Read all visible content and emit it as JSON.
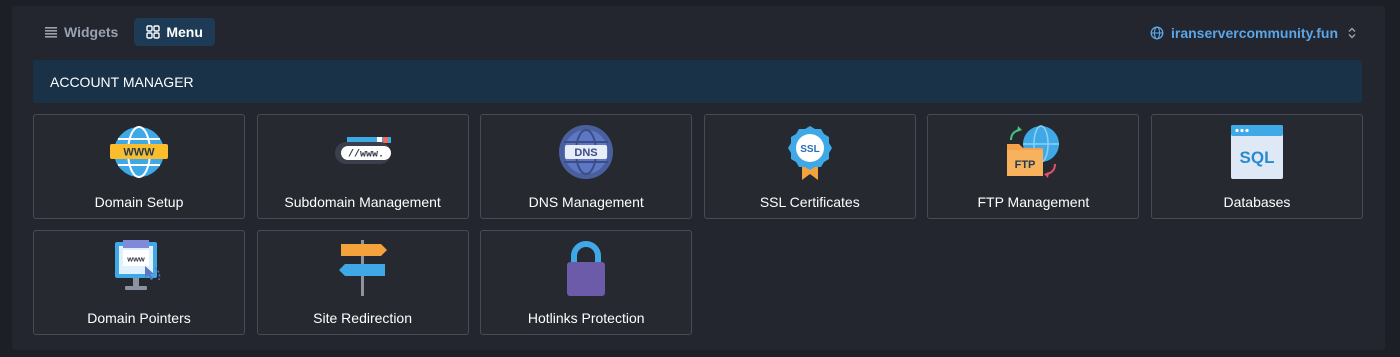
{
  "tabs": [
    {
      "label": "Widgets",
      "icon": "list-icon"
    },
    {
      "label": "Menu",
      "icon": "grid-icon"
    }
  ],
  "domain_selector": {
    "value": "iranservercommunity.fun",
    "icon": "globe-icon"
  },
  "section": {
    "title": "ACCOUNT MANAGER"
  },
  "cards": [
    {
      "label": "Domain Setup",
      "icon": "www-globe-icon"
    },
    {
      "label": "Subdomain Management",
      "icon": "subdomain-bar-icon"
    },
    {
      "label": "DNS Management",
      "icon": "dns-globe-icon"
    },
    {
      "label": "SSL Certificates",
      "icon": "ssl-badge-icon"
    },
    {
      "label": "FTP Management",
      "icon": "ftp-folder-icon"
    },
    {
      "label": "Databases",
      "icon": "sql-window-icon"
    },
    {
      "label": "Domain Pointers",
      "icon": "monitor-www-icon"
    },
    {
      "label": "Site Redirection",
      "icon": "signpost-icon"
    },
    {
      "label": "Hotlinks Protection",
      "icon": "padlock-icon"
    }
  ],
  "icon_text": {
    "www": "WWW",
    "subdomain": "//www.",
    "dns": "DNS",
    "ssl": "SSL",
    "ftp": "FTP",
    "sql": "SQL",
    "pointer": "www"
  },
  "colors": {
    "background": "#1c1f26",
    "panel": "#23262e",
    "active_tab": "#1d3a57",
    "section_header": "#1a3248",
    "accent_blue": "#5aa6e8",
    "card_border": "#474b55"
  }
}
